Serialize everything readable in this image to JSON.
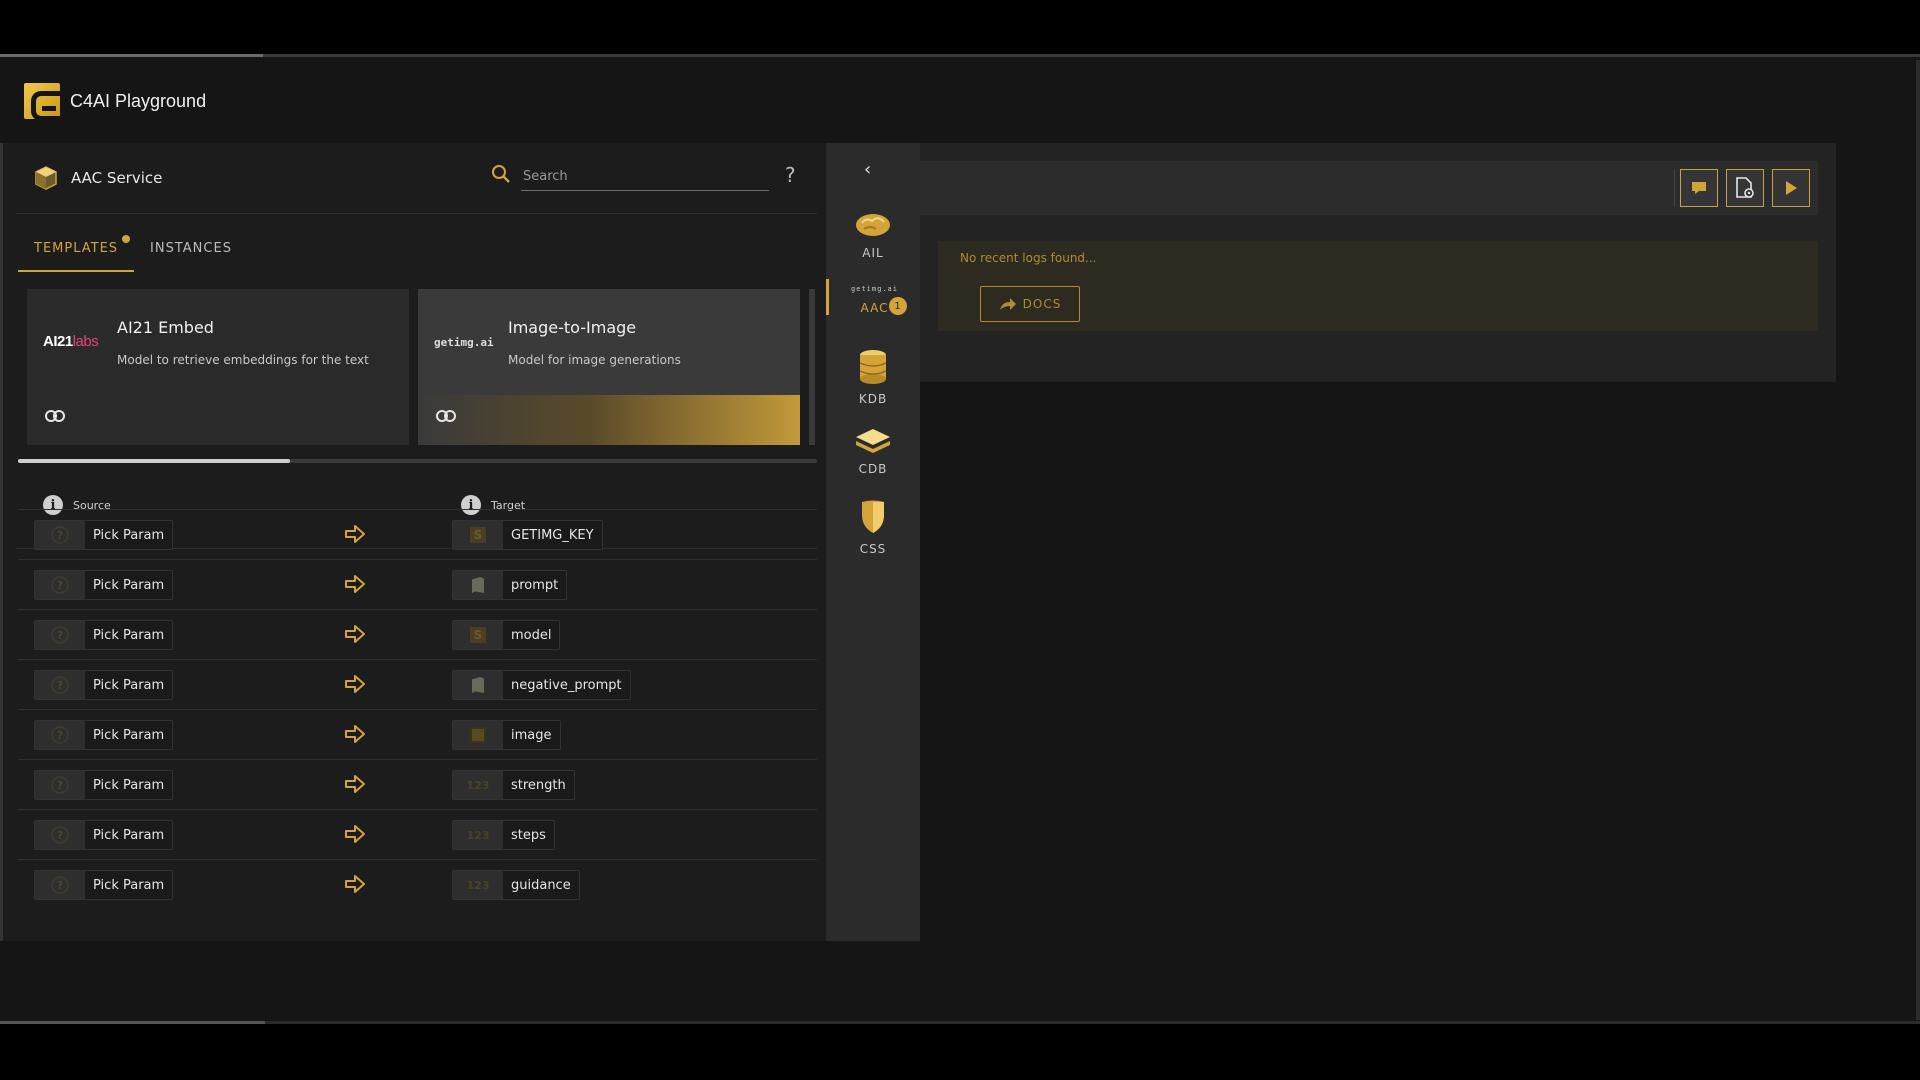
{
  "app": {
    "title": "C4AI Playground"
  },
  "service": {
    "name": "AAC Service"
  },
  "search": {
    "placeholder": "Search"
  },
  "help": {
    "label": "?"
  },
  "tabs": [
    {
      "label": "TEMPLATES",
      "active": true,
      "has_dot": true
    },
    {
      "label": "INSTANCES",
      "active": false
    }
  ],
  "cards": [
    {
      "logo_main": "AI21",
      "logo_sub": "labs",
      "title": "AI21 Embed",
      "description": "Model to retrieve embeddings for the text",
      "icon": "link-icon"
    },
    {
      "logo_main": "getimg.ai",
      "title": "Image-to-Image",
      "description": "Model for image generations",
      "icon": "link-icon",
      "highlighted": true
    }
  ],
  "card_scroll_position": 0.34,
  "mapping": {
    "source_header": "Source",
    "target_header": "Target",
    "rows": [
      {
        "source": "Pick Param",
        "target": "GETIMG_KEY",
        "target_type": "secret"
      },
      {
        "source": "Pick Param",
        "target": "prompt",
        "target_type": "text"
      },
      {
        "source": "Pick Param",
        "target": "model",
        "target_type": "secret"
      },
      {
        "source": "Pick Param",
        "target": "negative_prompt",
        "target_type": "text"
      },
      {
        "source": "Pick Param",
        "target": "image",
        "target_type": "image"
      },
      {
        "source": "Pick Param",
        "target": "strength",
        "target_type": "number"
      },
      {
        "source": "Pick Param",
        "target": "steps",
        "target_type": "number"
      },
      {
        "source": "Pick Param",
        "target": "guidance",
        "target_type": "number"
      }
    ],
    "number_icon_text": "123"
  },
  "sidebar": {
    "back_icon": "chevron-left-icon",
    "items": [
      {
        "label": "AIL",
        "icon": "brain-icon"
      },
      {
        "label": "AAC",
        "icon_text": "getimg.ai",
        "badge": "1",
        "active": true
      },
      {
        "label": "KDB",
        "icon": "database-icon"
      },
      {
        "label": "CDB",
        "icon": "layers-icon"
      },
      {
        "label": "CSS",
        "icon": "shield-icon"
      }
    ]
  },
  "logs": {
    "message": "No recent logs found...",
    "docs_label": "DOCS"
  },
  "colors": {
    "accent": "#d4a43a",
    "panel": "#1c1c1c",
    "sidebar": "#2b2b2b"
  }
}
